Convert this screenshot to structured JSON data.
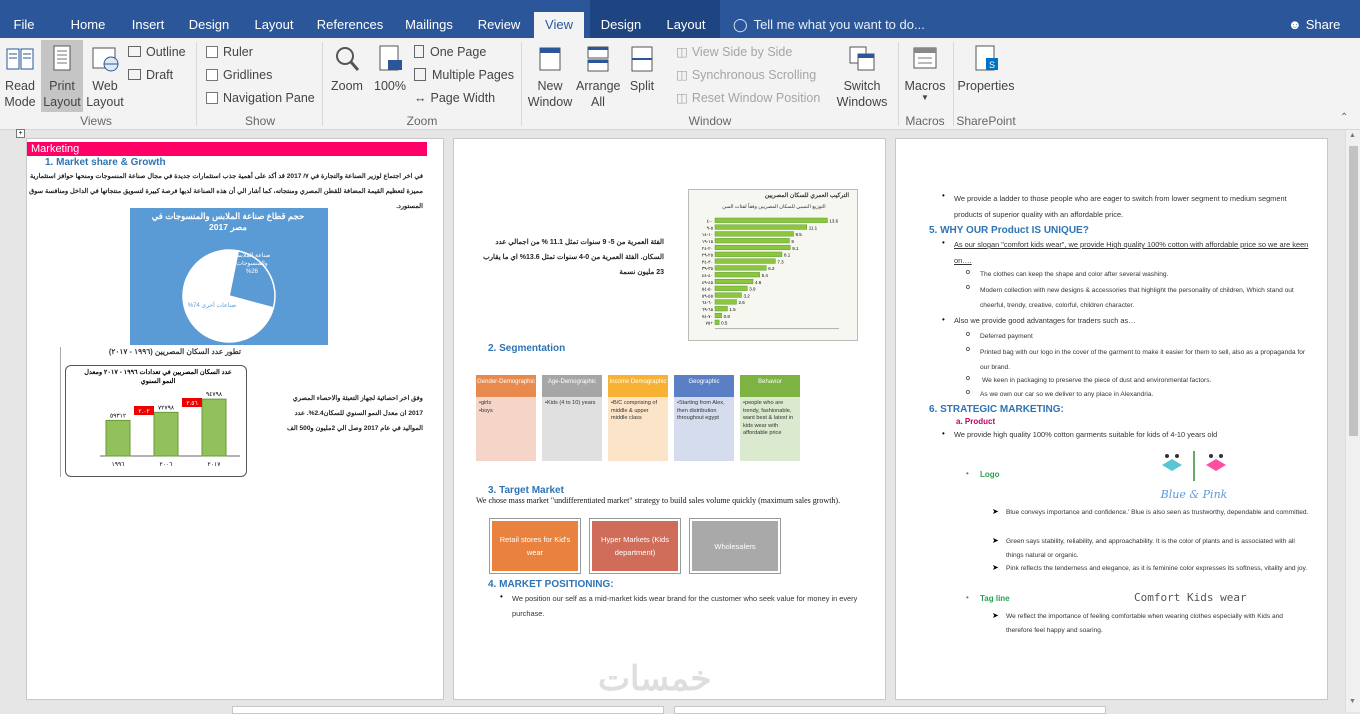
{
  "tabs": [
    {
      "label": "File"
    },
    {
      "label": "Home"
    },
    {
      "label": "Insert"
    },
    {
      "label": "Design"
    },
    {
      "label": "Layout"
    },
    {
      "label": "References"
    },
    {
      "label": "Mailings"
    },
    {
      "label": "Review"
    },
    {
      "label": "View"
    },
    {
      "label": "Design"
    },
    {
      "label": "Layout"
    }
  ],
  "tell": "Tell me what you want to do...",
  "share": "Share",
  "views": {
    "read": "Read Mode",
    "print": "Print Layout",
    "web": "Web Layout",
    "outline": "Outline",
    "draft": "Draft",
    "label": "Views"
  },
  "show": {
    "ruler": "Ruler",
    "gridlines": "Gridlines",
    "nav": "Navigation Pane",
    "label": "Show"
  },
  "zoom": {
    "zoom": "Zoom",
    "pct": "100%",
    "one": "One Page",
    "multi": "Multiple Pages",
    "width": "Page Width",
    "label": "Zoom"
  },
  "window": {
    "new": "New Window",
    "arrange": "Arrange All",
    "split": "Split",
    "side": "View Side by Side",
    "sync": "Synchronous Scrolling",
    "reset": "Reset Window Position",
    "switch": "Switch Windows",
    "label": "Window"
  },
  "macros": {
    "btn": "Macros",
    "label": "Macros"
  },
  "sp": {
    "btn": "Properties",
    "label": "SharePoint"
  },
  "p1": {
    "banner": "Marketing",
    "h1": "1.  Market share & Growth",
    "para": "في اخر اجتماع لوزير الصناعة والتجارة في ٧/ 2017 قد أكد على أهمية جذب استثمارات جديدة في مجال صناعة المنسوجات ومنحها حوافز استثمارية مميزة لتعظيم القيمة المضافة للقطن المصري ومنتجاته، كما أشار الي أن هذه الصناعة لديها فرصة كبيرة لتسويق منتجاتها في الداخل ومنافسة سوق المستورد.",
    "pie_title": "حجم قطاع صناعة الملابس والمنسوجات في مصر 2017",
    "pie_a": "صناعة الملابس والمنسوجات 26%",
    "pie_b": "صناعات أخرى 74%",
    "bar_head": "تطور عدد السكان المصريين (١٩٩٦ - ٢٠١٧)",
    "bar_title": "عدد السكان المصريين في تعدادات ١٩٩٦ - ٢٠١٧ ومعدل النمو السنوي",
    "bar_years": [
      "١٩٩٦",
      "٢٠٠٦",
      "٢٠١٧"
    ],
    "bar_vals": [
      "٥٩٣١٢",
      "٧٢٧٩٨",
      "٩٤٧٩٨"
    ],
    "bar_rates": [
      "٢.٠٢",
      "٢.٥٦"
    ],
    "p_right": "وفق اخر احصائية لجهاز التعبئة والاحصاء المصري 2017 ان معدل النمو السنوي للسكان2.4%. عدد المواليد في عام 2017 وصل الي 2مليون و500 الف"
  },
  "p2": {
    "age_text": "الفئة العمرية من 5- 9 سنوات تمثل 11.1 % من اجمالي عدد السكان. الفئة العمرية من 0-4 سنوات تمثل 13.6% اي ما يقارب 23 مليون نسمة",
    "age_title": "التركيب العمري للسكان المصريين",
    "age_sub": "التوزيع النسبي للسكان المصريين وفقاً لفئات السن",
    "h2": "2.  Segmentation",
    "seg": [
      {
        "head": "Gender-Demographic",
        "body": "•girls\n•boys",
        "hc": "#e88a4e",
        "bc": "#f5d5c8"
      },
      {
        "head": "Age-Demographic",
        "body": "•Kids (4 to 10) years",
        "hc": "#a6a6a6",
        "bc": "#e0e0e0"
      },
      {
        "head": "Income Demographic",
        "body": "•B/C comprising of middle & upper middle class",
        "hc": "#f7b233",
        "bc": "#fce4c8"
      },
      {
        "head": "Geographic",
        "body": "•Starting from Alex, then distribution throughout egypt",
        "hc": "#5b7fc5",
        "bc": "#d5dcee"
      },
      {
        "head": "Behavior",
        "body": "•people who are trendy, fashionable, want best & latest in kids wear with affordable price",
        "hc": "#7cb342",
        "bc": "#dbe9cf"
      }
    ],
    "h3": "3.  Target Market",
    "tm_text": "We chose mass market \"undifferentiated market\" strategy to build sales volume quickly (maximum sales growth).",
    "tm_boxes": [
      {
        "label": "Retail stores for Kid's wear",
        "c": "#e8823e"
      },
      {
        "label": "Hyper Markets (Kids department)",
        "c": "#cf6d5a"
      },
      {
        "label": "Wholesalers",
        "c": "#a9a9a9"
      }
    ],
    "h4": "4.  MARKET POSITIONING:",
    "pos": "We position our self as a mid-market kids wear brand for the customer who seek value for money in every purchase."
  },
  "p3": {
    "b1": "We provide a ladder to those people who are eager to switch from lower segment to medium segment products of superior quality with an affordable price.",
    "h5": "5.  WHY OUR Product IS UNIQUE?",
    "b2": "As our slogan \"comfort kids wear\", we provide High quality 100% cotton with affordable price so we are keen on….",
    "s1": "The clothes can keep the shape and color after several washing.",
    "s2": "Modern collection with new designs & accessories that highlight the personality of children, Which stand out cheerful, trendy, creative, colorful, children character.",
    "b3": "Also we provide good advantages for traders such as…",
    "s3": "Deferred payment",
    "s4": "Printed bag with our logo in the cover of the garment to make it easier for them to sell, also as a propaganda for our brand.",
    "s5": "We keen in packaging to preserve the piece of dust and environmental factors.",
    "s6": "As we own our car so we deliver to any place in Alexandria.",
    "h6": "6.  STRATEGIC MARKETING:",
    "ha": "a.   Product",
    "b4": "We provide high quality 100% cotton garments suitable for kids of 4-10 years old",
    "logo_lbl": "Logo",
    "brand": "Blue & Pink",
    "l1": "Blue conveys importance and confidence.' Blue is also seen as trustworthy, dependable and committed.",
    "l2": "Green says stability, reliability, and approachability. It is the color of plants and is associated with all things natural or organic.",
    "l3": "Pink reflects the tenderness and elegance, as it is feminine color expresses its softness, vitality and joy.",
    "tag_lbl": "Tag line",
    "tag": "Comfort Kids wear",
    "tg1": "We reflect the importance of feeling comfortable when wearing clothes especially with Kids and therefore feel happy and soaring."
  },
  "watermark": "خمسات",
  "chart_data": [
    {
      "type": "pie",
      "title": "حجم قطاع صناعة الملابس والمنسوجات في مصر 2017",
      "categories": [
        "صناعة الملابس والمنسوجات",
        "صناعات أخرى"
      ],
      "values": [
        26,
        74
      ]
    },
    {
      "type": "bar",
      "title": "عدد السكان المصريين في تعدادات ١٩٩٦ - ٢٠١٧ ومعدل النمو السنوي",
      "categories": [
        "١٩٩٦",
        "٢٠٠٦",
        "٢٠١٧"
      ],
      "values": [
        59312,
        72798,
        94798
      ],
      "ylim": [
        0,
        100000
      ],
      "annotations": [
        "٢.٠٢",
        "٢.٥٦"
      ]
    },
    {
      "type": "bar",
      "orientation": "horizontal",
      "title": "التركيب العمري للسكان المصريين",
      "categories": [
        "٠-٤",
        "٥-٩",
        "١٠-١٤",
        "١٥-١٩",
        "٢٠-٢٤",
        "٢٥-٢٩",
        "٣٠-٣٤",
        "٣٥-٣٩",
        "٤٠-٤٤",
        "٤٥-٤٩",
        "٥٠-٥٤",
        "٥٥-٥٩",
        "٦٠-٦٤",
        "٦٥-٦٩",
        "٧٠-٧٤",
        "٧٥+"
      ],
      "values": [
        13.6,
        11.1,
        9.5,
        9.0,
        9.1,
        8.1,
        7.3,
        6.2,
        5.4,
        4.6,
        3.9,
        3.2,
        2.6,
        1.5,
        0.8,
        0.5
      ],
      "xlim": [
        0,
        15
      ]
    }
  ]
}
